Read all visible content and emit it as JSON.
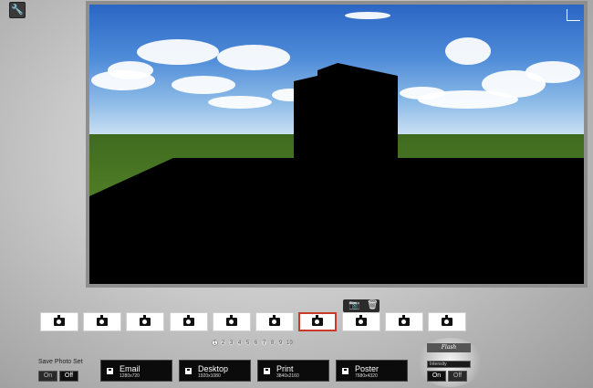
{
  "toolbar": {
    "wrench_icon": "wrench-icon"
  },
  "camera_tools": {
    "camera_icon": "camera-icon",
    "trash_icon": "trash-icon"
  },
  "photo_slots": [
    {
      "icon": "camera-icon",
      "selected": false
    },
    {
      "icon": "camera-icon",
      "selected": false
    },
    {
      "icon": "camera-icon",
      "selected": false
    },
    {
      "icon": "camera-icon",
      "selected": false
    },
    {
      "icon": "camera-icon",
      "selected": false
    },
    {
      "icon": "camera-icon",
      "selected": false
    },
    {
      "icon": "camera-icon",
      "selected": true
    },
    {
      "icon": "camera-icon",
      "selected": false
    },
    {
      "icon": "camera-icon",
      "selected": false
    },
    {
      "icon": "camera-icon",
      "selected": false
    }
  ],
  "pager": {
    "pages": [
      "1",
      "2",
      "3",
      "4",
      "5",
      "6",
      "7",
      "8",
      "9",
      "10"
    ],
    "current": "1"
  },
  "save_photo_set": {
    "label": "Save Photo Set",
    "on": "On",
    "off": "Off",
    "value": "Off"
  },
  "resolutions": [
    {
      "name": "Email",
      "size": "1280x720"
    },
    {
      "name": "Desktop",
      "size": "1920x1080"
    },
    {
      "name": "Print",
      "size": "3840x2160"
    },
    {
      "name": "Poster",
      "size": "7680x4320"
    }
  ],
  "flash": {
    "logo_text": "Flash",
    "intensity_label": "Intensity",
    "on": "On",
    "off": "Off",
    "value": "On"
  },
  "colors": {
    "accent_selected": "#c83a2a",
    "button_bg": "#0b0b0b"
  }
}
